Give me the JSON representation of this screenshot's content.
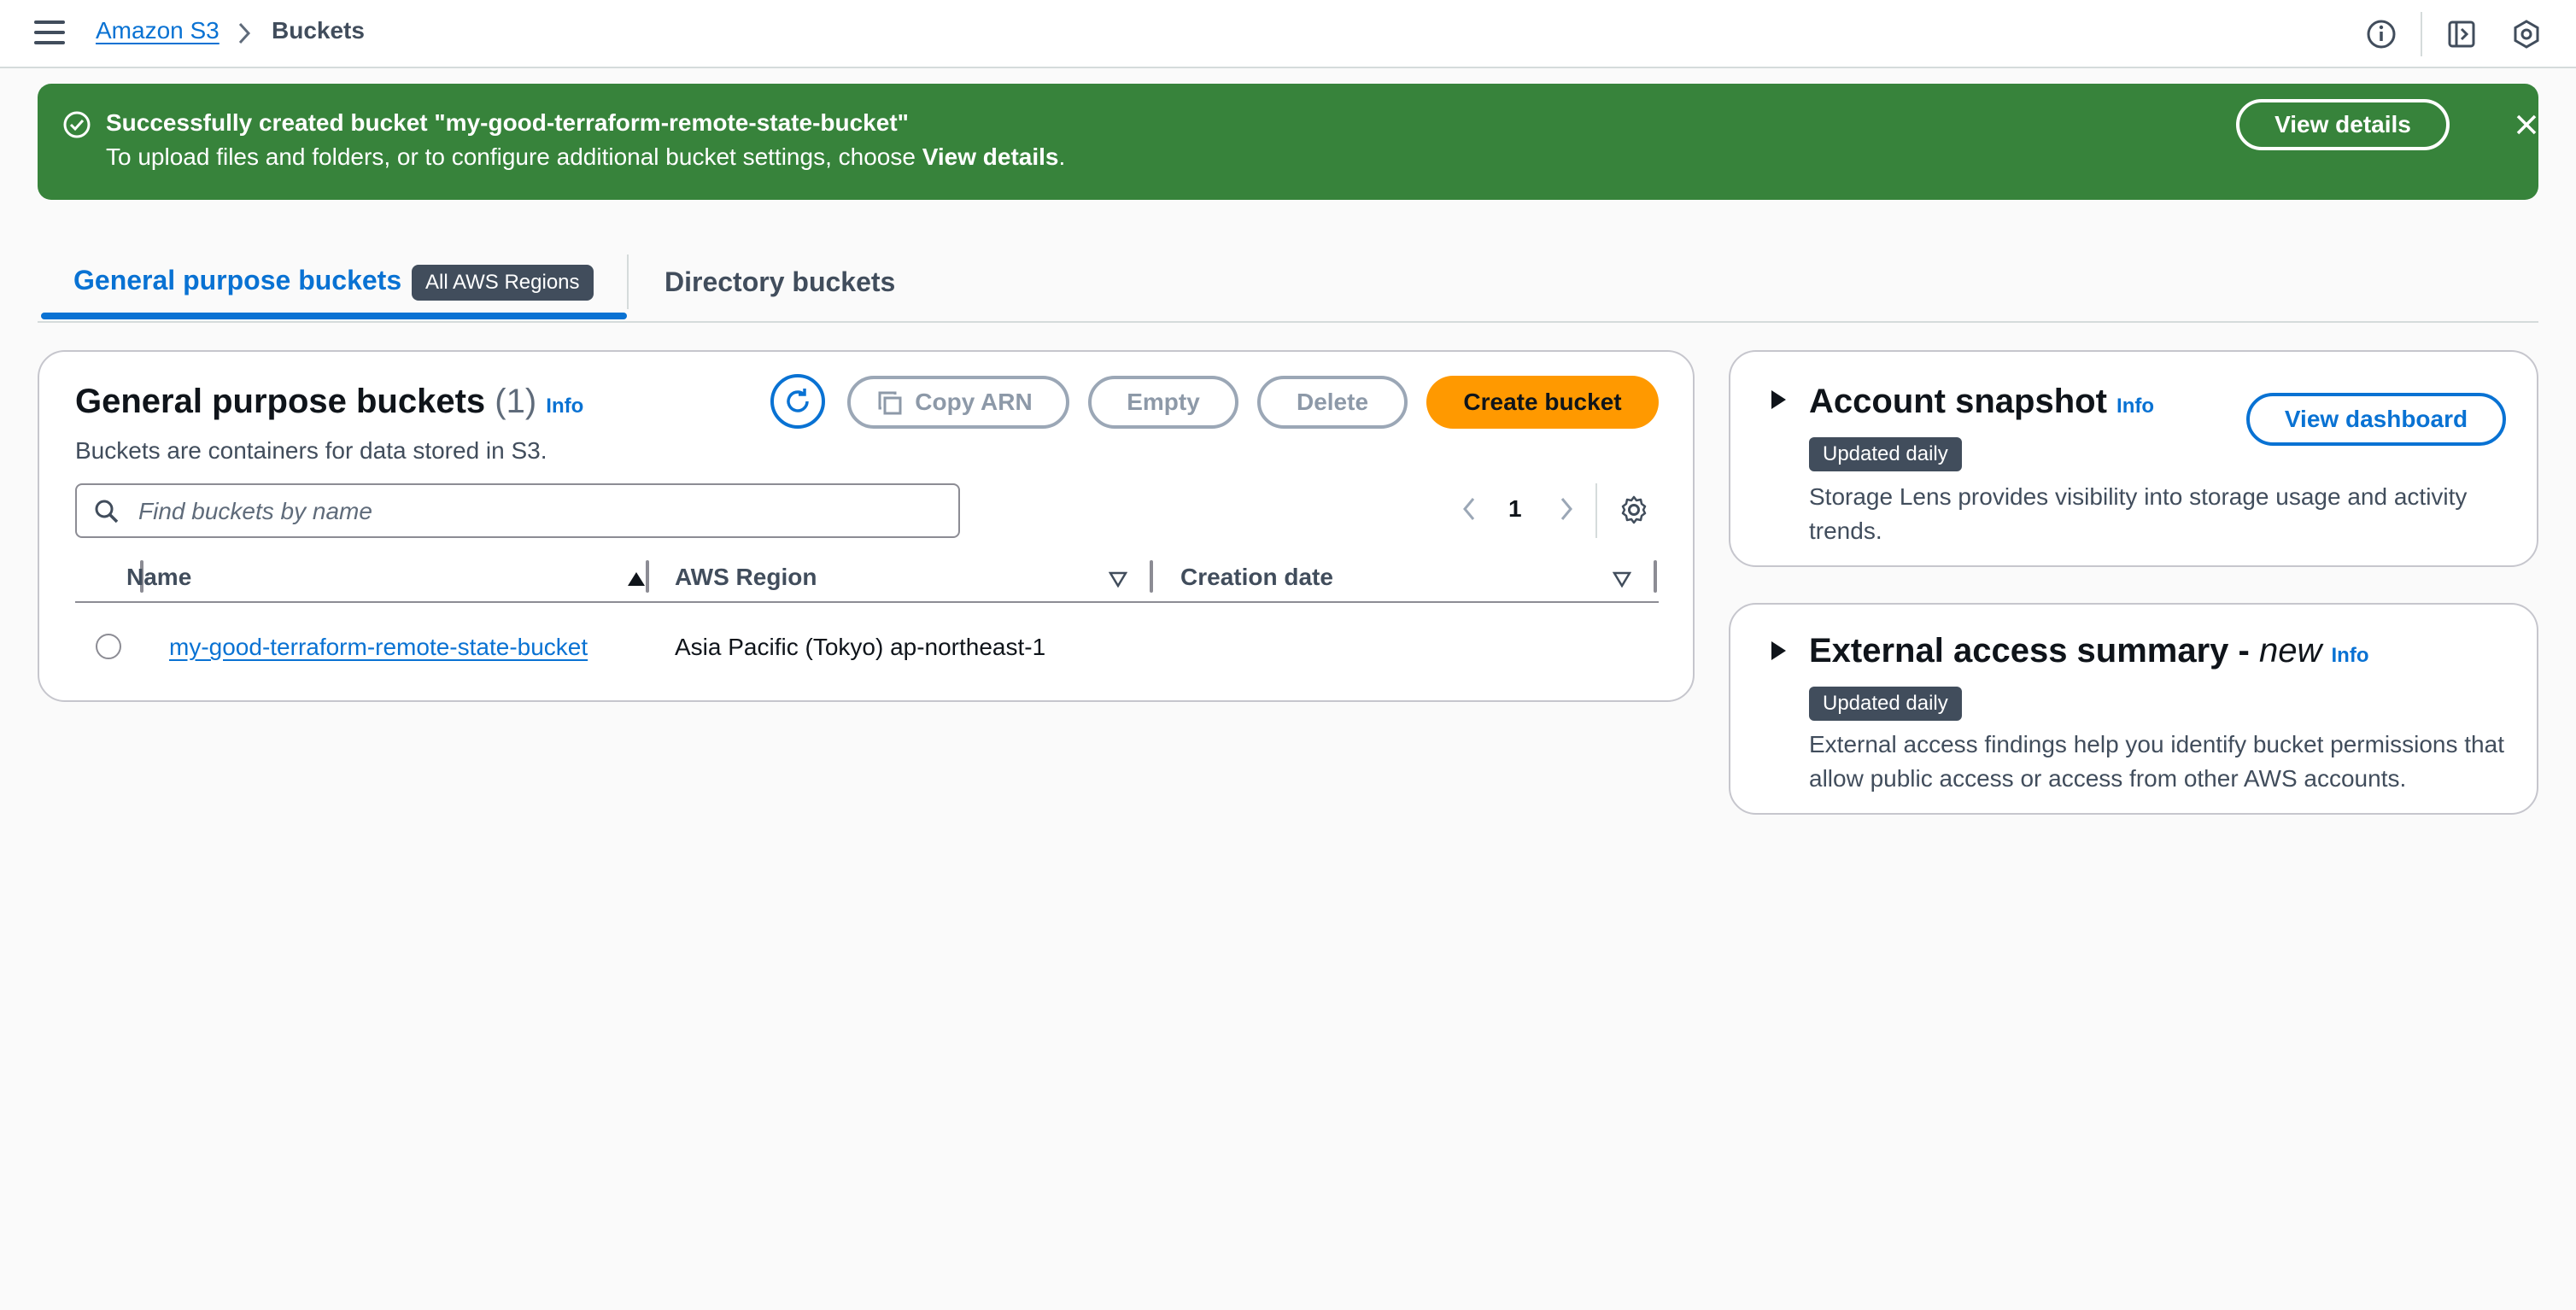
{
  "breadcrumb": {
    "root": "Amazon S3",
    "current": "Buckets"
  },
  "flash": {
    "title": "Successfully created bucket \"my-good-terraform-remote-state-bucket\"",
    "message_prefix": "To upload files and folders, or to configure additional bucket settings, choose ",
    "message_bold": "View details",
    "message_suffix": ".",
    "button": "View details",
    "color": "#37833b"
  },
  "tabs": {
    "active": "General purpose buckets",
    "active_badge": "All AWS Regions",
    "other": "Directory buckets"
  },
  "buckets_panel": {
    "title": "General purpose buckets",
    "count": "(1)",
    "info": "Info",
    "description": "Buckets are containers for data stored in S3.",
    "actions": {
      "copy_arn": "Copy ARN",
      "empty": "Empty",
      "delete": "Delete",
      "create": "Create bucket"
    },
    "search_placeholder": "Find buckets by name",
    "page": "1",
    "columns": [
      "Name",
      "AWS Region",
      "Creation date"
    ],
    "rows": [
      {
        "name": "my-good-terraform-remote-state-bucket",
        "region": "Asia Pacific (Tokyo) ap-northeast-1",
        "created": ""
      }
    ]
  },
  "account_snapshot": {
    "title": "Account snapshot",
    "info": "Info",
    "badge": "Updated daily",
    "text": "Storage Lens provides visibility into storage usage and activity trends.",
    "button": "View dashboard"
  },
  "external_access": {
    "title": "External access summary - ",
    "title_em": "new",
    "info": "Info",
    "badge": "Updated daily",
    "text": "External access findings help you identify bucket permissions that allow public access or access from other AWS accounts."
  },
  "colors": {
    "accent": "#0972d3",
    "primary_button": "#ff9900",
    "badge": "#414d5c"
  }
}
